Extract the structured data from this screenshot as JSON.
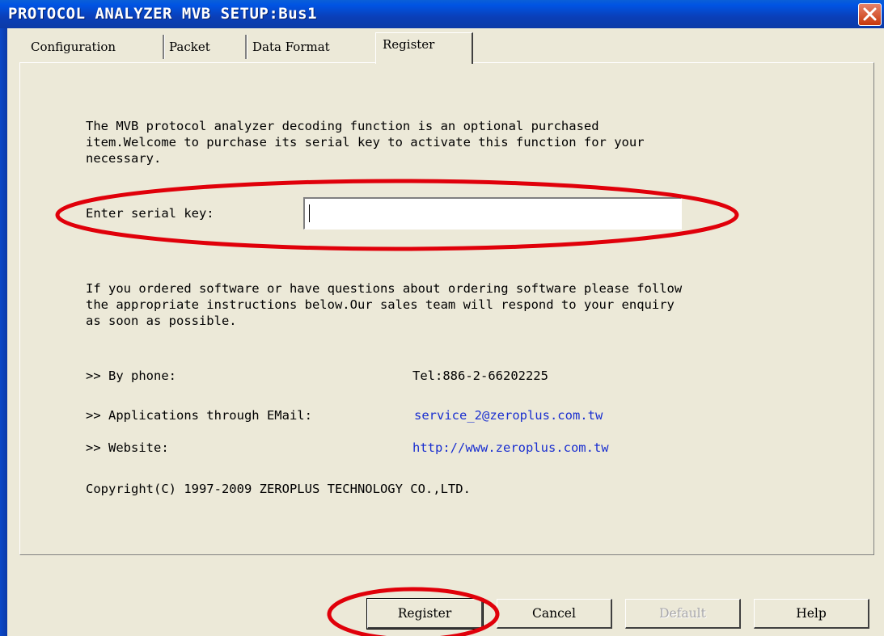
{
  "window": {
    "title": "PROTOCOL ANALYZER MVB SETUP:Bus1"
  },
  "tabs": [
    {
      "label": "Configuration",
      "active": false
    },
    {
      "label": "Packet",
      "active": false
    },
    {
      "label": "Data Format",
      "active": false
    },
    {
      "label": "Register",
      "active": true
    }
  ],
  "register": {
    "intro_lines": [
      "The MVB protocol analyzer decoding function is an optional purchased",
      "item.Welcome to purchase its serial key to activate this function for your",
      "necessary."
    ],
    "serial_label": "Enter serial key:",
    "serial_value": "",
    "info_lines": [
      "If you ordered software or have questions about ordering software please follow",
      "the appropriate instructions below.Our sales team will respond to your enquiry",
      "as soon as possible."
    ],
    "phone_label": ">> By phone:",
    "phone_value": "Tel:886-2-66202225",
    "email_label": ">> Applications through EMail:",
    "email_value": "service_2@zeroplus.com.tw",
    "website_label": ">> Website:",
    "website_value": "http://www.zeroplus.com.tw",
    "copyright": "Copyright(C) 1997-2009 ZEROPLUS TECHNOLOGY CO.,LTD."
  },
  "buttons": {
    "register": "Register",
    "cancel": "Cancel",
    "default": "Default",
    "help": "Help"
  },
  "colors": {
    "titlebar": "#0054e3",
    "dialog_bg": "#ece9d8",
    "link": "#1a2fd0",
    "annotation": "#e0000a"
  }
}
